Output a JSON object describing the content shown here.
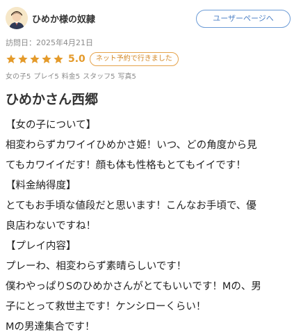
{
  "header": {
    "username": "ひめか様の奴隷",
    "user_page_button": "ユーザーページへ"
  },
  "visit": {
    "date_text": "訪問日：2025年4月21日"
  },
  "rating": {
    "stars": 5,
    "score": "5.0",
    "reserve_badge": "ネット予約で行きました",
    "star_color": "#e49a2a"
  },
  "sub_ratings": [
    "女の子5",
    "プレイ5",
    "料金5",
    "スタッフ5",
    "写真5"
  ],
  "review": {
    "title": "ひめかさん西郷",
    "lines": [
      "【女の子について】",
      "相変わらずカワイイひめかさ姫！いつ、どの角度から見",
      "てもカワイイだす！顔も体も性格もとてもイイです！",
      "【料金納得度】",
      "とてもお手頃な値段だと思います！こんなお手頃で、優",
      "良店わないですね！",
      "【プレイ内容】",
      "プレーわ、相変わらず素晴らしいです！",
      "僕わやっぱりSのひめかさんがとてもいいです！Mの、男",
      "子にとって救世主です！ケンシローくらい！",
      "Mの男達集合です！"
    ]
  }
}
